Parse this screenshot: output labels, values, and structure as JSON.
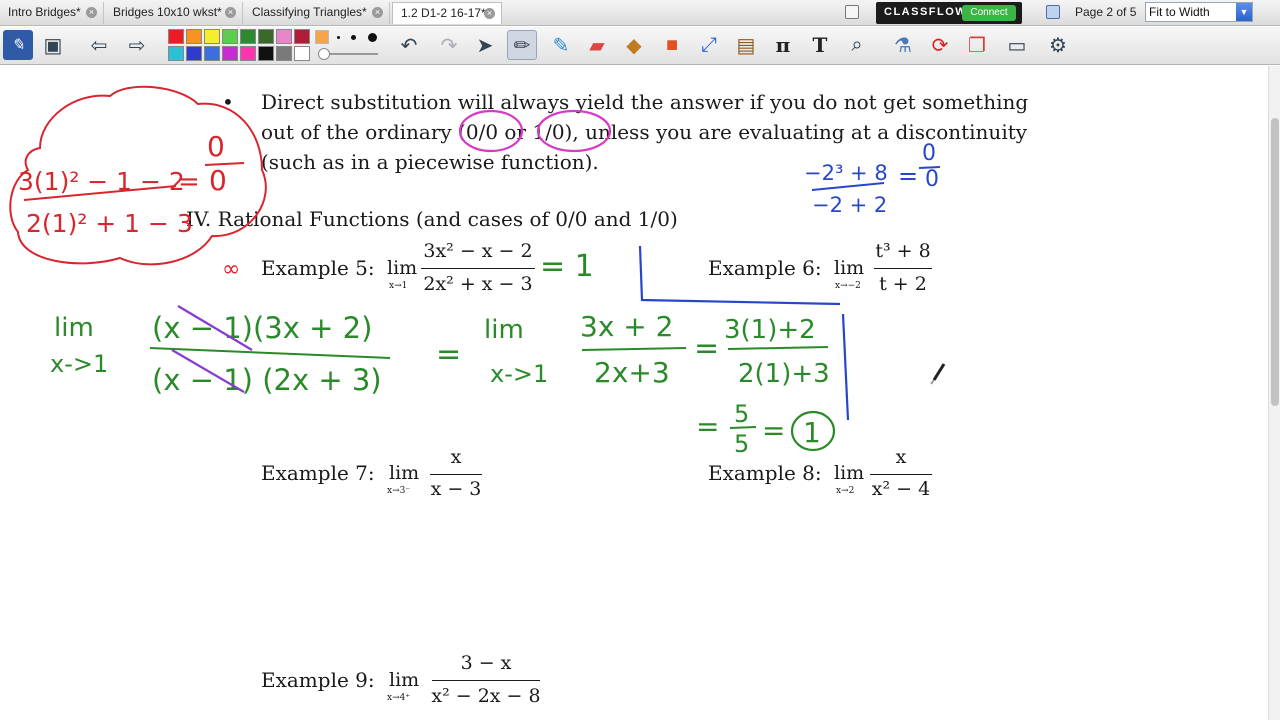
{
  "tabs": [
    {
      "label": "Intro Bridges*"
    },
    {
      "label": "Bridges 10x10 wkst*"
    },
    {
      "label": "Classifying Triangles*"
    },
    {
      "label": "1.2 D1-2 16-17*"
    }
  ],
  "header": {
    "classflow_brand": "CLASSFLOW",
    "connect_label": "Connect",
    "page_indicator": "Page 2 of 5",
    "zoom_value": "Fit to Width"
  },
  "palette": [
    "#ed1c24",
    "#f7931e",
    "#f6ed2b",
    "#5bcf4d",
    "#3a7a2a",
    "#e985c9",
    "#b01c38",
    "#2bc0d4",
    "#2e3cc9",
    "#c92bd2",
    "#ff34b0",
    "#111111",
    "#7a7a7a",
    "#ffffff"
  ],
  "icons": [
    "annotate-icon",
    "select-region-icon",
    "back-arrow-icon",
    "forward-arrow-icon",
    "undo-icon",
    "redo-icon",
    "pointer-icon",
    "pen-icon",
    "highlighter-icon",
    "eraser-icon",
    "fill-icon",
    "shape-icon",
    "connector-icon",
    "media-icon",
    "pi-icon",
    "text-icon",
    "magnifier-icon",
    "lab-icon",
    "reset-icon",
    "pages-icon",
    "notes-icon",
    "settings-icon"
  ],
  "document": {
    "bullet": "•",
    "bullet_lines": [
      "Direct substitution will always yield the answer if you do not get something",
      "out of the ordinary (0/0 or 1/0), unless you are evaluating at a discontinuity",
      "(such as in a piecewise function)."
    ],
    "section_heading": "IV. Rational Functions (and cases of 0/0 and 1/0)",
    "lim_word": "lim",
    "examples": [
      {
        "label": "Example 5:",
        "sub": "x→1",
        "num": "3x² − x − 2",
        "den": "2x² + x − 3"
      },
      {
        "label": "Example 6:",
        "sub": "x→−2",
        "num": "t³ + 8",
        "den": "t + 2"
      },
      {
        "label": "Example 7:",
        "sub": "x→3⁻",
        "num": "x",
        "den": "x − 3"
      },
      {
        "label": "Example 8:",
        "sub": "x→2",
        "num": "x",
        "den": "x² − 4"
      },
      {
        "label": "Example 9:",
        "sub": "x→4⁺",
        "num": "3 − x",
        "den": "x² − 2x − 8"
      }
    ]
  },
  "annotations": {
    "red_cloud_num": "3(1)² − 1 − 2",
    "red_cloud_den": "2(1)² + 1 − 3",
    "red_cloud_eq": "=",
    "red_cloud_zero_top": "0",
    "red_cloud_zero_bot": "0",
    "red_infinity": "∞",
    "green_ex5_result": "= 1",
    "green_lim_word": "lim",
    "green_lim_sub": "x->1",
    "green_num_1": "(x − 1)(3x + 2)",
    "green_den_1": "(x − 1) (2x + 3)",
    "green_eq": "=",
    "green_lim_word_2": "lim",
    "green_lim_sub_2": "x->1",
    "green_num_2": "3x + 2",
    "green_den_2": "2x+3",
    "green_eq_2": "=",
    "green_num_3": "3(1)+2",
    "green_den_3": "2(1)+3",
    "green_final_eq": "=",
    "green_final_num": "5",
    "green_final_den": "5",
    "green_final_eq_2": "=",
    "green_final_result": "1",
    "blue_num": "−2³ + 8",
    "blue_den": "−2 + 2",
    "blue_eq": "=",
    "blue_zero_top": "0",
    "blue_zero_bot": "0"
  }
}
